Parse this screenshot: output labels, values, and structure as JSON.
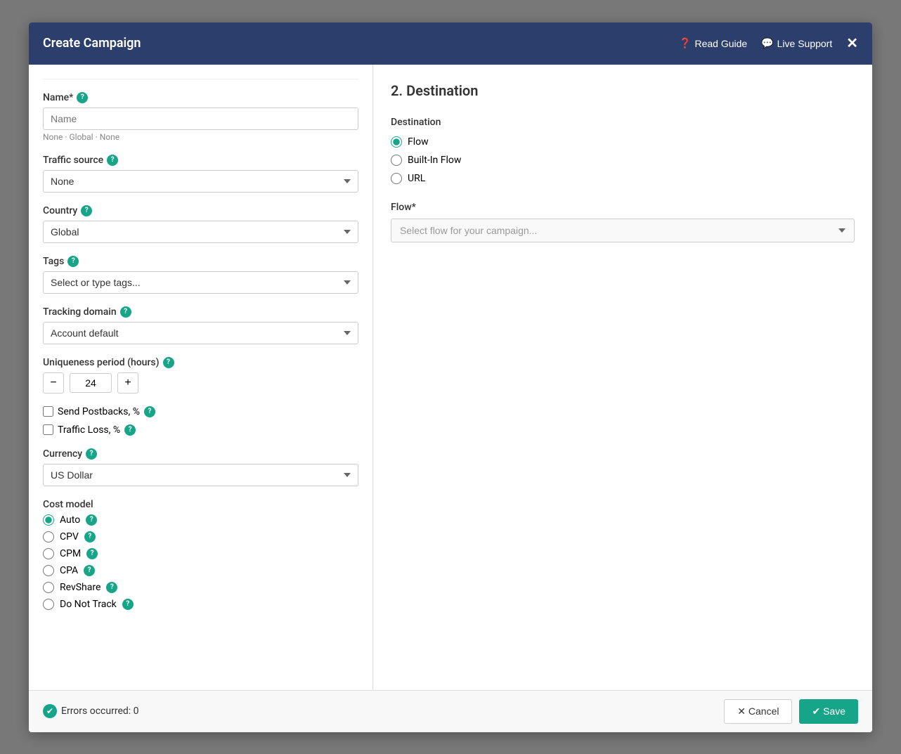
{
  "modal": {
    "title": "Create Campaign",
    "header_actions": {
      "read_guide": "Read Guide",
      "live_support": "Live Support"
    }
  },
  "left_panel": {
    "name_label": "Name*",
    "name_placeholder": "Name",
    "breadcrumb": "None · Global · None",
    "traffic_source_label": "Traffic source",
    "traffic_source_value": "None",
    "country_label": "Country",
    "country_value": "Global",
    "tags_label": "Tags",
    "tags_placeholder": "Select or type tags...",
    "tracking_domain_label": "Tracking domain",
    "tracking_domain_value": "Account default",
    "uniqueness_label": "Uniqueness period (hours)",
    "uniqueness_value": "24",
    "send_postbacks_label": "Send Postbacks, %",
    "traffic_loss_label": "Traffic Loss, %",
    "currency_label": "Currency",
    "currency_value": "US Dollar",
    "cost_model_label": "Cost model",
    "cost_model_options": [
      {
        "id": "auto",
        "label": "Auto",
        "checked": true
      },
      {
        "id": "cpv",
        "label": "CPV",
        "checked": false
      },
      {
        "id": "cpm",
        "label": "CPM",
        "checked": false
      },
      {
        "id": "cpa",
        "label": "CPA",
        "checked": false
      },
      {
        "id": "revshare",
        "label": "RevShare",
        "checked": false
      },
      {
        "id": "donottrack",
        "label": "Do Not Track",
        "checked": false
      }
    ]
  },
  "right_panel": {
    "section_title": "2. Destination",
    "destination_label": "Destination",
    "destination_options": [
      {
        "id": "flow",
        "label": "Flow",
        "checked": true
      },
      {
        "id": "builtin",
        "label": "Built-In Flow",
        "checked": false
      },
      {
        "id": "url",
        "label": "URL",
        "checked": false
      }
    ],
    "flow_label": "Flow*",
    "flow_placeholder": "Select flow for your campaign..."
  },
  "footer": {
    "errors_label": "Errors occurred: 0",
    "cancel_label": "✕ Cancel",
    "save_label": "✔ Save"
  },
  "icons": {
    "question": "?",
    "check": "✔",
    "close": "✕"
  },
  "colors": {
    "teal": "#17a589",
    "header_bg": "#2c3e6b"
  }
}
